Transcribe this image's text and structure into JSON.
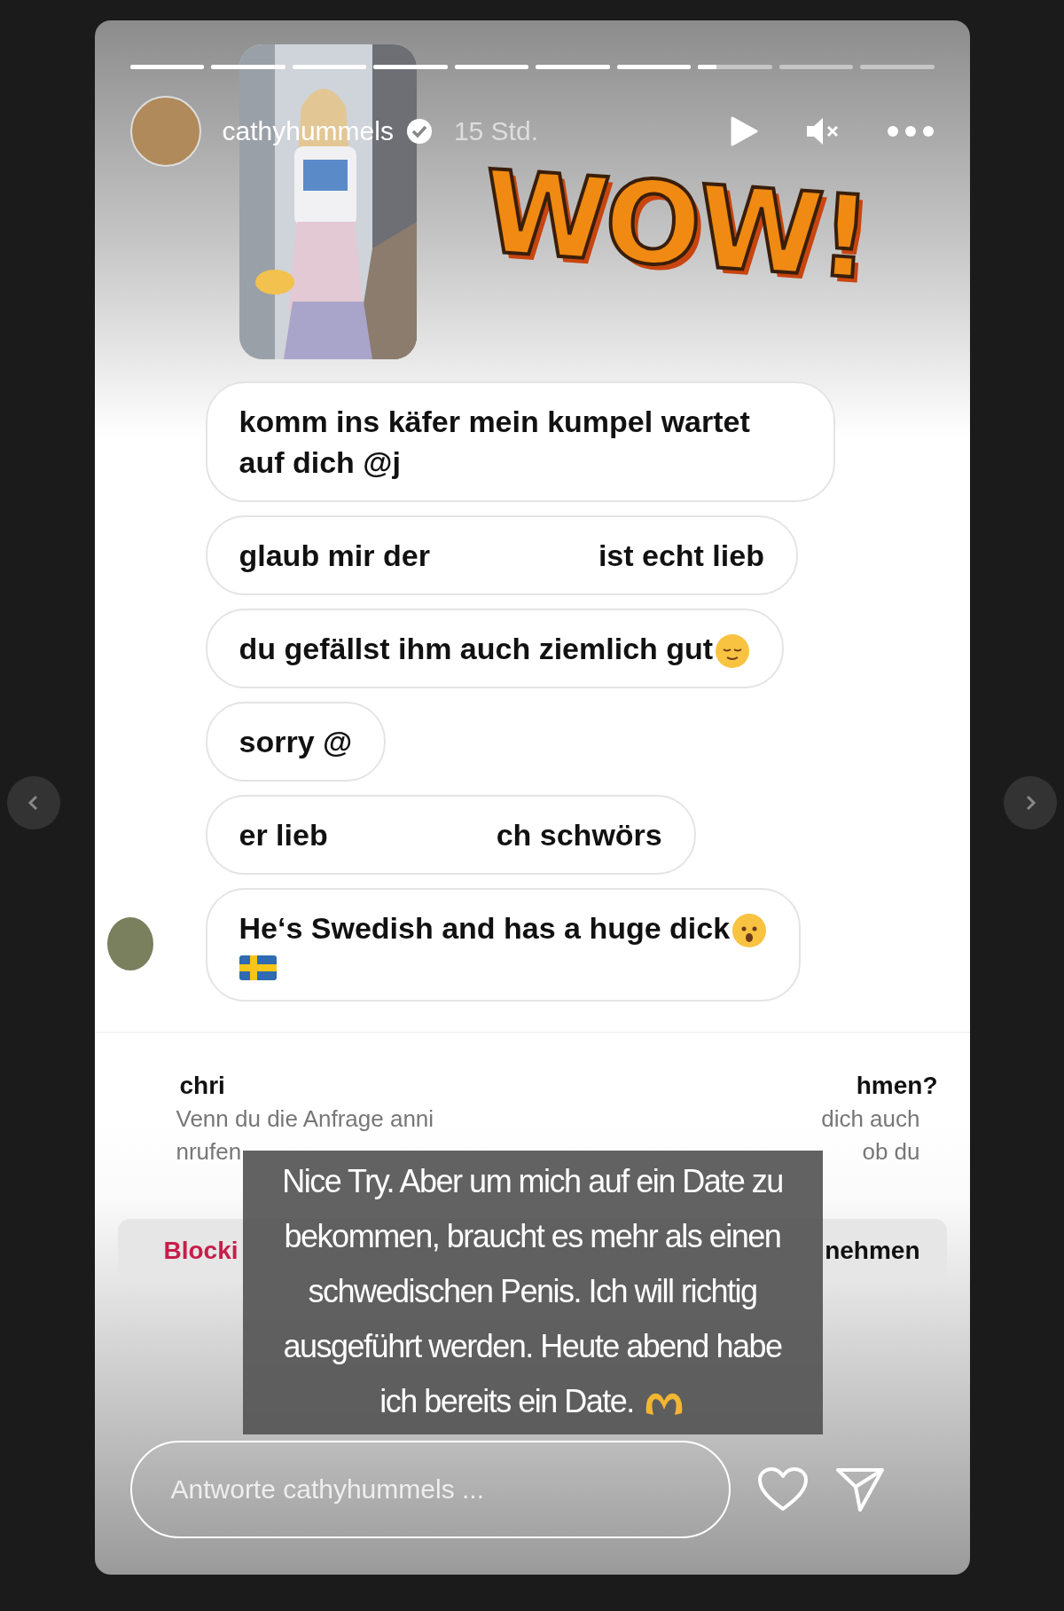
{
  "progress": [
    {
      "seen": true
    },
    {
      "seen": true
    },
    {
      "seen": true
    },
    {
      "seen": true
    },
    {
      "seen": true
    },
    {
      "seen": true
    },
    {
      "seen": true
    },
    {
      "level": 0.25
    },
    {
      "seen": false
    },
    {
      "seen": false
    }
  ],
  "header": {
    "username": "cathyhummels",
    "verified": true,
    "time": "15 Std."
  },
  "sticker": {
    "text": "WOW!"
  },
  "messages": [
    {
      "kind": "text",
      "parts": [
        "komm ins käfer mein kumpel wartet auf dich @j"
      ]
    },
    {
      "kind": "text",
      "parts": [
        "glaub mir der",
        "ist echt lieb"
      ]
    },
    {
      "kind": "relieved",
      "parts": [
        "du gefällst ihm auch ziemlich gut"
      ]
    },
    {
      "kind": "text",
      "parts": [
        "sorry @"
      ]
    },
    {
      "kind": "text",
      "parts": [
        "er lieb",
        "ch schwörs"
      ]
    },
    {
      "kind": "worried-flag",
      "parts": [
        "He‘s Swedish and has a huge dick"
      ]
    }
  ],
  "request": {
    "title_parts": [
      "chri",
      "hmen?"
    ],
    "lines": [
      [
        "Venn du die Anfrage anni",
        "dich auch"
      ],
      [
        "nrufen",
        "ob du"
      ]
    ],
    "buttons": [
      {
        "label": "Blocki",
        "kind": "danger"
      },
      {
        "label": "nehmen",
        "kind": "default"
      }
    ]
  },
  "caption": {
    "text": "Nice Try. Aber um mich auf ein Date zu bekommen, braucht es mehr als einen schwedischen Penis. Ich will richtig ausgeführt werden. Heute abend habe ich bereits ein Date.",
    "kind": "hands"
  },
  "reply": {
    "placeholder": "Antworte cathyhummels ..."
  }
}
